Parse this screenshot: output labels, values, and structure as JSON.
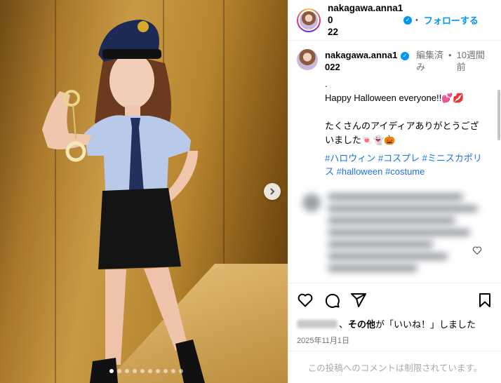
{
  "post": {
    "username": "nakagawa.anna1022",
    "username_header_line1": "nakagawa.anna10",
    "username_header_line2": "22",
    "follow_separator": "•",
    "follow_label": "フォローする",
    "verified_icon": "check"
  },
  "caption": {
    "username_line1": "nakagawa.anna1",
    "username_line2": "022",
    "edited_line1": "編集済",
    "edited_line2": "み",
    "dot": "•",
    "time_line1": "10週間",
    "time_line2": "前",
    "text": ".\nHappy Halloween everyone!!💕💋\n\nたくさんのアイディアありがとうござ\nいました🍬👻🎃",
    "hashtags": "#ハロウィン #コスプレ #ミニスカポリス #halloween #costume"
  },
  "likes": {
    "text_bold": "その他",
    "text_rest": "が「いいね！」しました",
    "separator": "、"
  },
  "date": "2025年11月1日",
  "comments_restricted": "この投稿へのコメントは制限されています。",
  "carousel": {
    "count": 10,
    "active_index": 0
  },
  "colors": {
    "accent": "#0095f6",
    "hashtag": "#1a73e8",
    "muted": "#737373"
  }
}
